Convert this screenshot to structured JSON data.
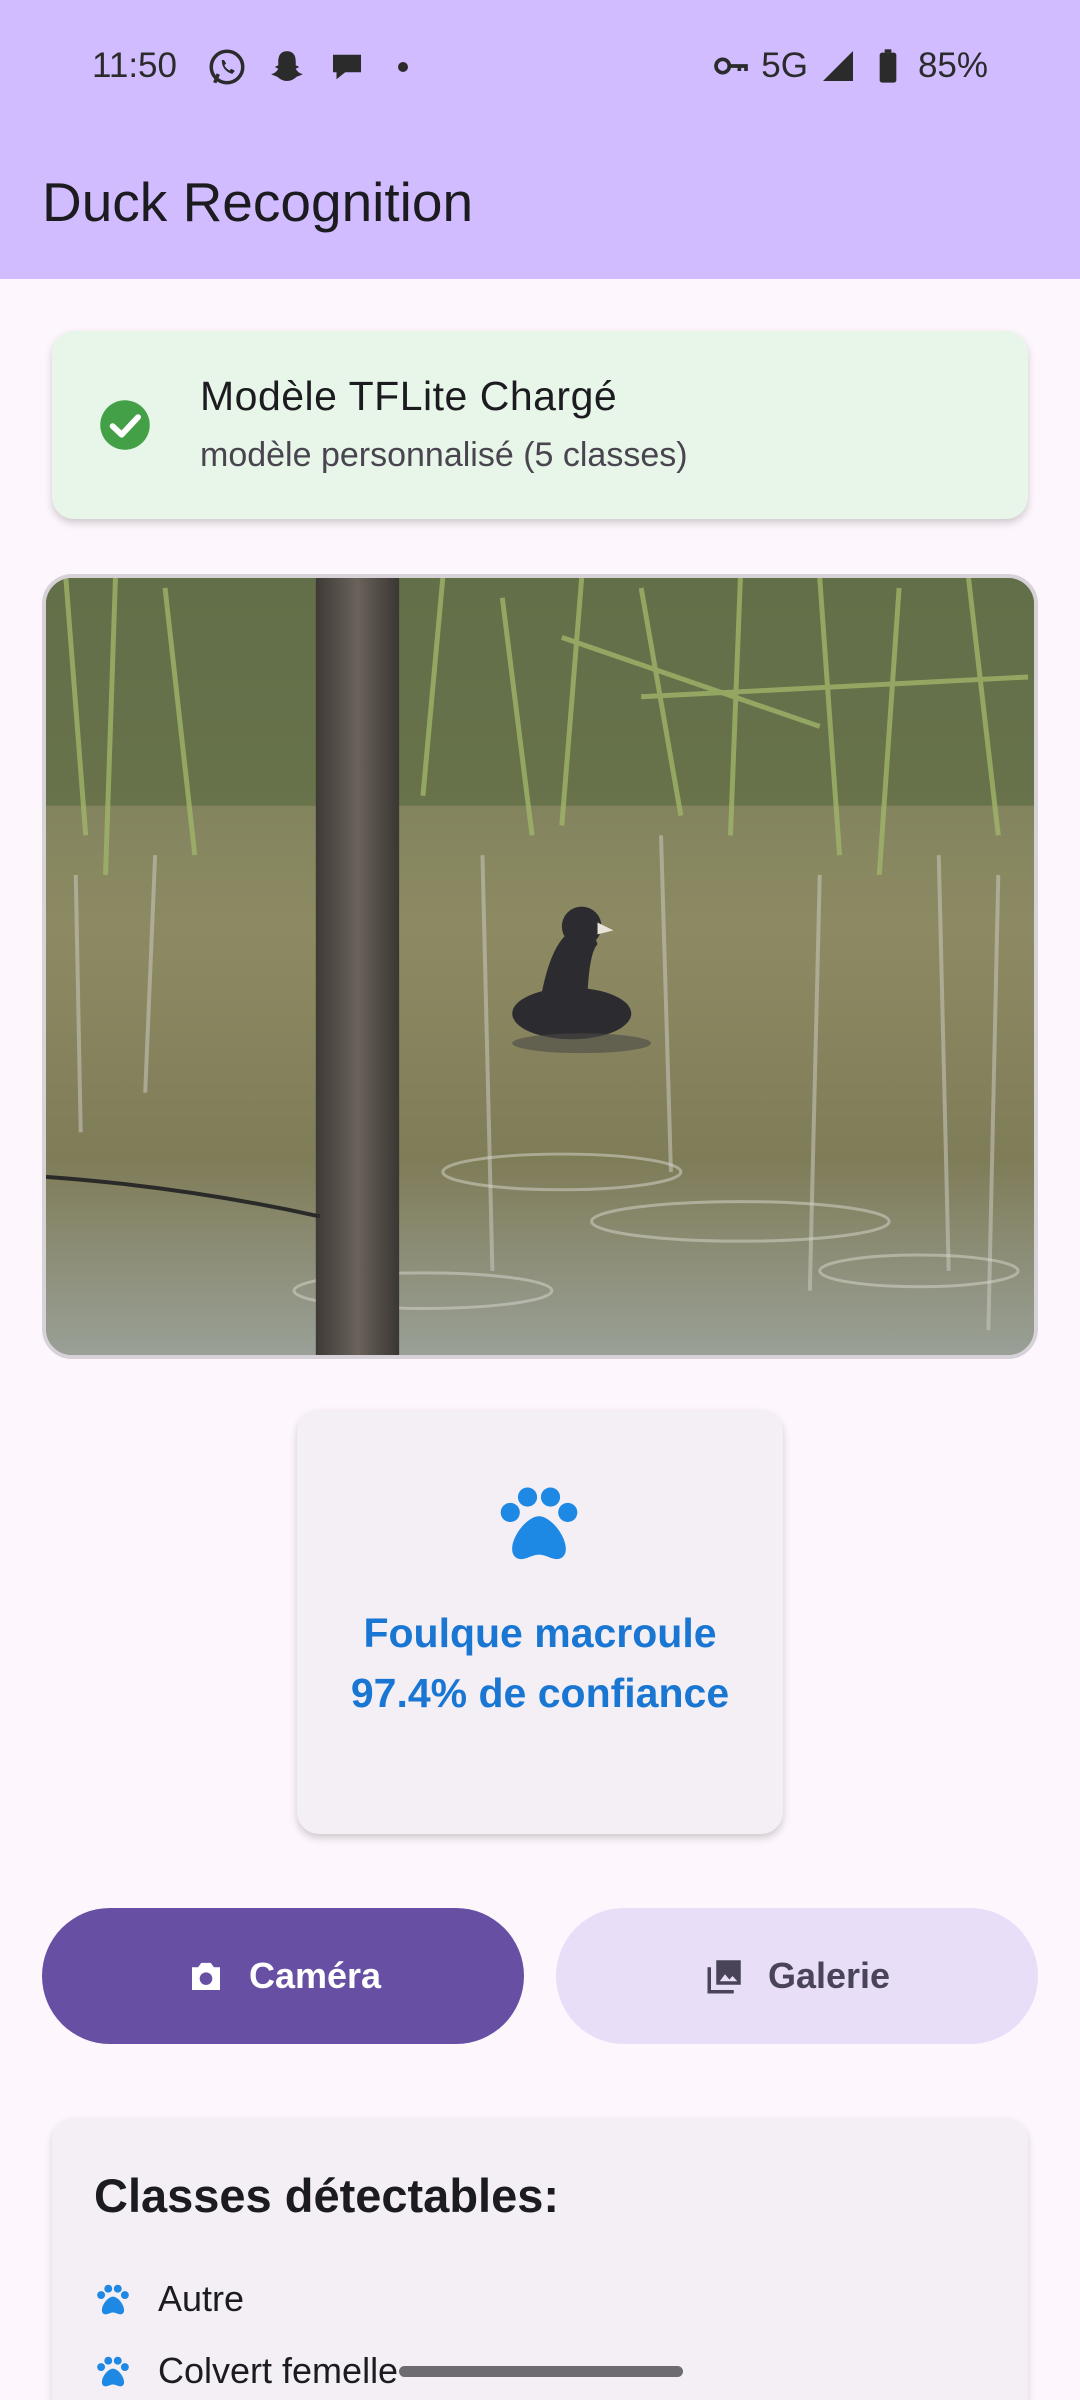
{
  "status_bar": {
    "time": "11:50",
    "network": "5G",
    "battery": "85%"
  },
  "app_bar": {
    "title": "Duck Recognition"
  },
  "model_status": {
    "title": "Modèle TFLite Chargé",
    "subtitle": "modèle personnalisé (5 classes)",
    "icon": "check-circle-icon",
    "color": "#43a047"
  },
  "result": {
    "icon": "paw-icon",
    "species": "Foulque macroule",
    "confidence": "97.4% de confiance",
    "color": "#1976d2"
  },
  "buttons": {
    "camera_label": "Caméra",
    "gallery_label": "Galerie"
  },
  "classes": {
    "title": "Classes détectables:",
    "items": [
      {
        "label": "Autre",
        "icon": "paw-icon"
      },
      {
        "label": "Colvert femelle",
        "icon": "paw-icon"
      }
    ]
  },
  "colors": {
    "app_bar": "#d0bcff",
    "primary": "#6750a4",
    "secondary_container": "#e8def8",
    "model_card": "#e8f5e9"
  }
}
